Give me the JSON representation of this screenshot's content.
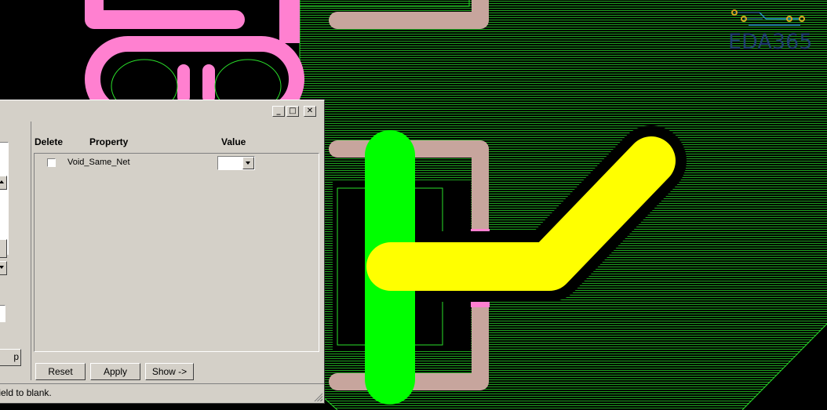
{
  "pcb_canvas": {
    "colors": {
      "background": "#000000",
      "copper_pour_lines": "#1fa31f",
      "outline": "#2adf2a",
      "pink_trace": "#ff80d0",
      "brown_trace": "#c7a59d",
      "green_trace": "#00ff00",
      "yellow_trace": "#ffff00"
    }
  },
  "logo": {
    "text": "EDA365",
    "icon": "circuit-trace-icon"
  },
  "dialog": {
    "title_buttons": {
      "minimize": "_",
      "maximize": "□",
      "close": "✕"
    },
    "table": {
      "headers": {
        "delete": "Delete",
        "property": "Property",
        "value": "Value"
      },
      "rows": [
        {
          "delete_checked": false,
          "property": "Void_Same_Net",
          "value": ""
        }
      ]
    },
    "left_panel": {
      "partial_button_label": "p"
    },
    "buttons": {
      "reset": "Reset",
      "apply": "Apply",
      "show": "Show ->"
    },
    "status": "field to blank."
  }
}
